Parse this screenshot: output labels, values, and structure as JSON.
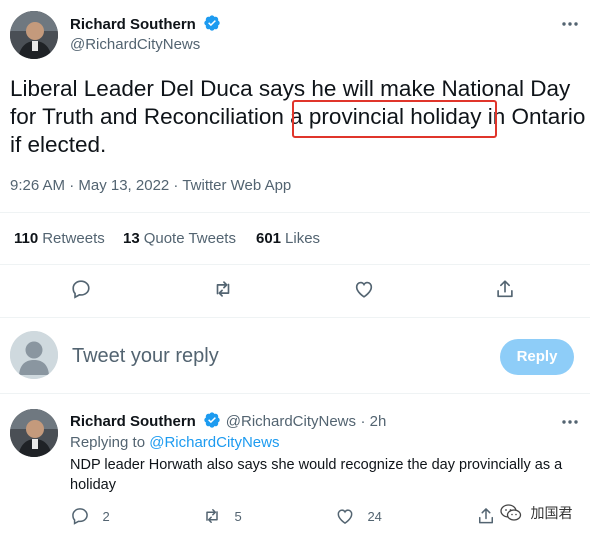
{
  "tweet": {
    "author_name": "Richard Southern",
    "author_handle": "@RichardCityNews",
    "text_part1": "Liberal Leader Del Duca says he will make National Day for Truth and Reconciliation ",
    "text_highlight": "a provincial holiday",
    "text_part2": " in Ontario if elected.",
    "timestamp": "9:26 AM · May 13, 2022 · Twitter Web App",
    "retweets_count": "110",
    "retweets_label": "Retweets",
    "quotes_count": "13",
    "quotes_label": "Quote Tweets",
    "likes_count": "601",
    "likes_label": "Likes"
  },
  "composer": {
    "placeholder": "Tweet your reply",
    "reply_button": "Reply"
  },
  "reply": {
    "author_name": "Richard Southern",
    "author_handle": "@RichardCityNews",
    "time": "· 2h",
    "replying_to_label": "Replying to",
    "replying_to_handle": "@RichardCityNews",
    "text": "NDP leader Horwath also says she would recognize the day provincially as a holiday",
    "reply_count": "2",
    "retweet_count": "5",
    "like_count": "24",
    "more": "···"
  },
  "watermark": {
    "text": "加国君"
  },
  "colors": {
    "accent": "#1d9bf0",
    "highlight": "#e0352b",
    "reply_button": "#8ecdf8"
  },
  "icons": [
    "verified-badge-icon",
    "reply-icon",
    "retweet-icon",
    "like-icon",
    "share-icon",
    "more-icon",
    "wechat-icon"
  ]
}
